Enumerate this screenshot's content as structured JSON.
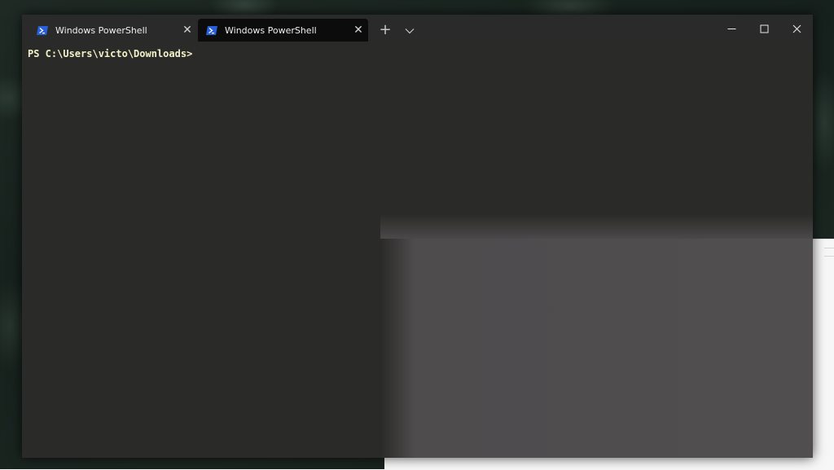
{
  "window": {
    "tabs": [
      {
        "label": "Windows PowerShell",
        "active": false,
        "icon": "powershell-icon"
      },
      {
        "label": "Windows PowerShell",
        "active": true,
        "icon": "powershell-icon"
      }
    ],
    "tab_close_glyph": "✕",
    "new_tab_glyph": "+",
    "dropdown_glyph": "⌄",
    "caption": {
      "minimize_glyph": "—",
      "maximize_glyph": "☐",
      "close_glyph": "✕"
    }
  },
  "console": {
    "prompt": "PS C:\\Users\\victo\\Downloads>"
  },
  "colors": {
    "titlebar": "#2a2a2a",
    "active_tab": "#0c0c0c",
    "prompt_text": "#f2f2c8",
    "powershell_icon": "#2b5fd9"
  }
}
